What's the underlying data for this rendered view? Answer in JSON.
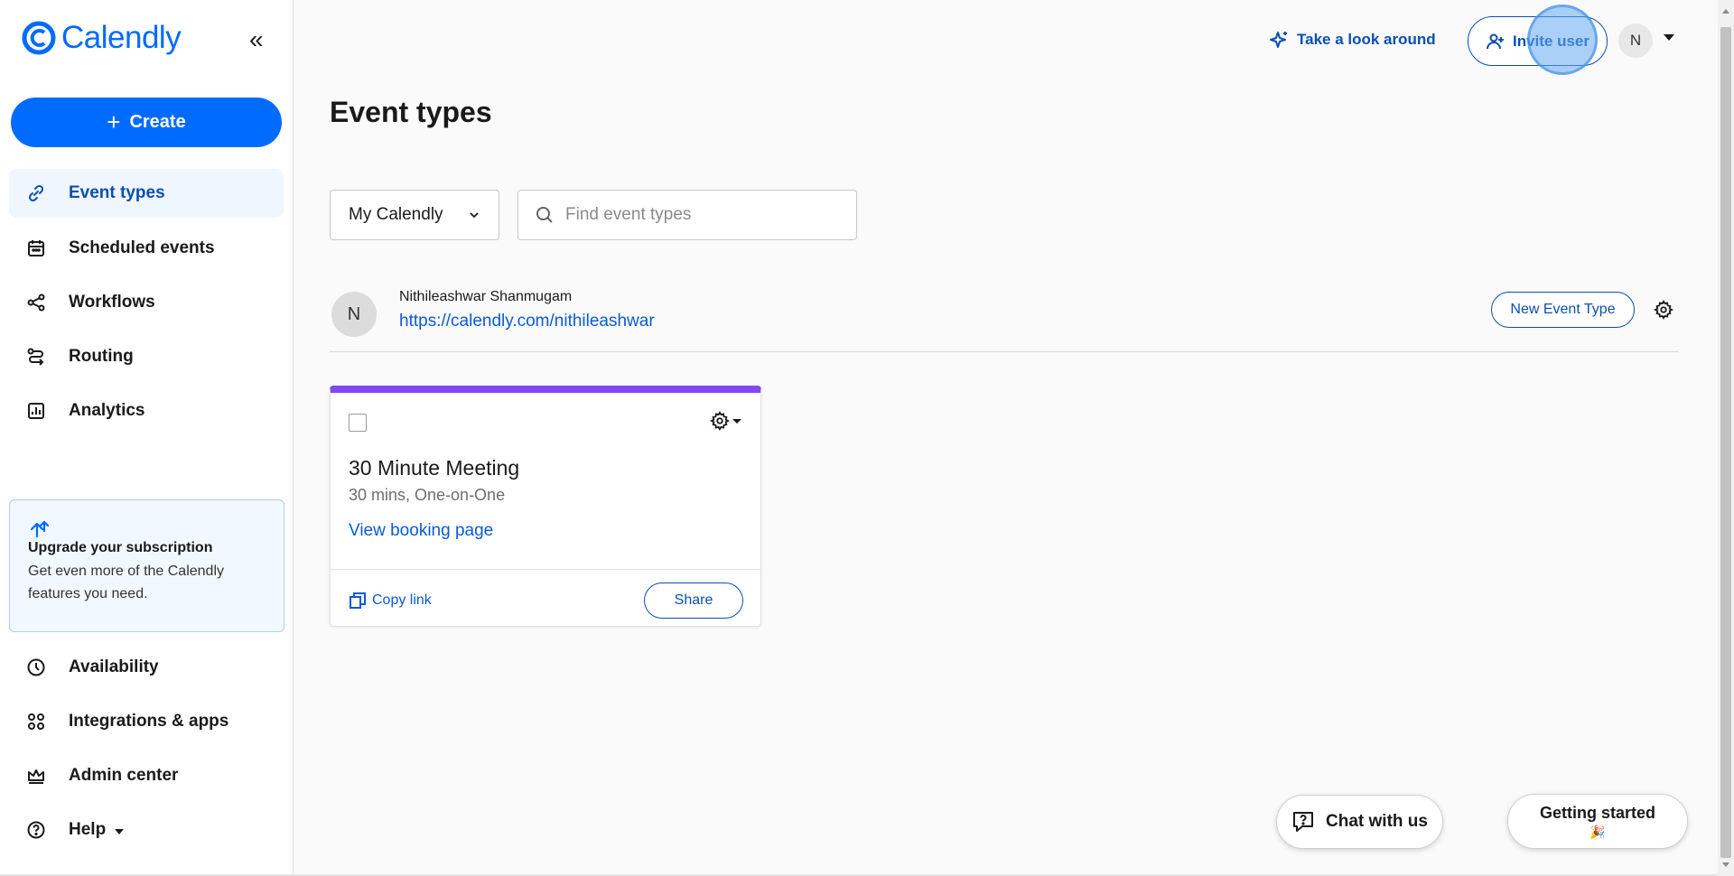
{
  "app": {
    "brand": "Calendly",
    "brand_color": "#006bff"
  },
  "sidebar": {
    "create_label": "Create",
    "nav_top": [
      {
        "label": "Event types",
        "icon": "link-icon",
        "active": true
      },
      {
        "label": "Scheduled events",
        "icon": "calendar-icon"
      },
      {
        "label": "Workflows",
        "icon": "workflow-icon"
      },
      {
        "label": "Routing",
        "icon": "routing-icon"
      },
      {
        "label": "Analytics",
        "icon": "analytics-icon"
      }
    ],
    "upgrade": {
      "title": "Upgrade your subscription",
      "text": "Get even more of the Calendly features you need."
    },
    "nav_bottom": [
      {
        "label": "Availability",
        "icon": "clock-icon"
      },
      {
        "label": "Integrations & apps",
        "icon": "apps-grid-icon"
      },
      {
        "label": "Admin center",
        "icon": "crown-icon"
      },
      {
        "label": "Help",
        "icon": "help-icon"
      }
    ]
  },
  "topbar": {
    "tour_label": "Take a look around",
    "invite_label": "Invite user",
    "avatar_initial": "N"
  },
  "main": {
    "title": "Event types",
    "filter": {
      "selected": "My Calendly"
    },
    "search": {
      "placeholder": "Find event types",
      "value": ""
    },
    "user": {
      "initial": "N",
      "name": "Nithileashwar Shanmugam",
      "link": "https://calendly.com/nithileashwar",
      "new_event_label": "New Event Type"
    },
    "cards": [
      {
        "title": "30 Minute Meeting",
        "subtitle": "30 mins, One-on-One",
        "view_label": "View booking page",
        "copy_label": "Copy link",
        "share_label": "Share",
        "accent": "#8247f5"
      }
    ]
  },
  "floating": {
    "chat_label": "Chat with us",
    "started_label": "Getting started",
    "started_emoji": "🎉"
  }
}
